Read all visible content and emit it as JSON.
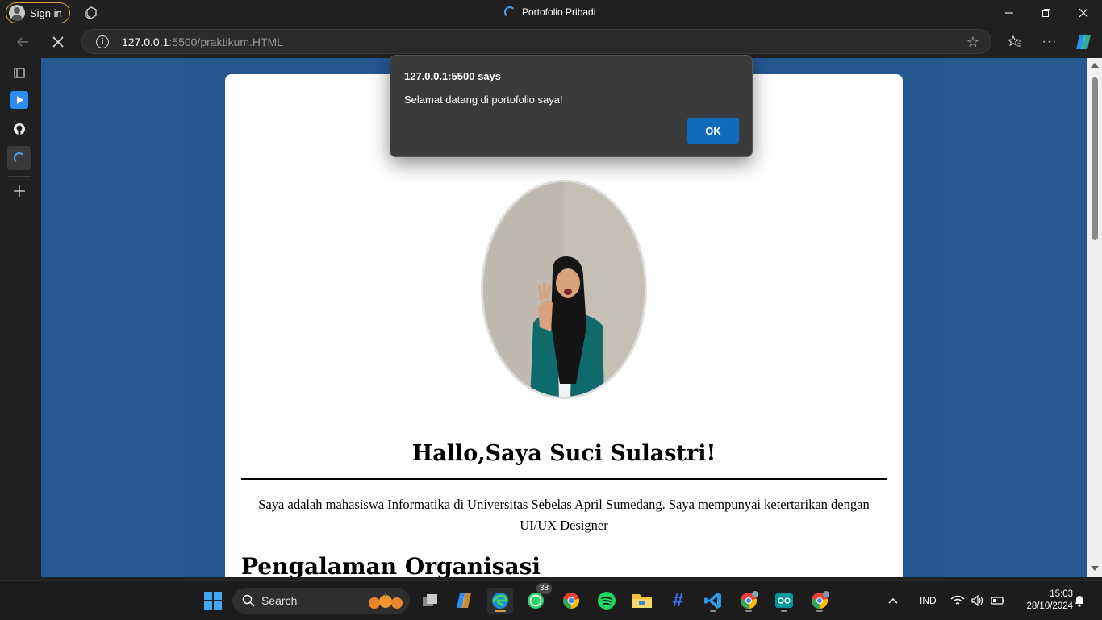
{
  "browser": {
    "sign_in_label": "Sign in",
    "tab_title": "Portofolio Pribadi",
    "url_host": "127.0.0.1",
    "url_rest": ":5500/praktikum.HTML"
  },
  "dialog": {
    "title": "127.0.0.1:5500 says",
    "message": "Selamat datang di portofolio saya!",
    "ok_label": "OK"
  },
  "page": {
    "heading": "Hallo,Saya Suci Sulastri!",
    "intro": "Saya adalah mahasiswa Informatika di Universitas Sebelas April Sumedang. Saya mempunyai ketertarikan dengan UI/UX Designer",
    "section_title": "Pengalaman Organisasi",
    "background_color": "#275a93"
  },
  "taskbar": {
    "search_label": "Search",
    "whatsapp_badge": "38",
    "language": "IND",
    "time": "15:03",
    "date": "28/10/2024"
  }
}
